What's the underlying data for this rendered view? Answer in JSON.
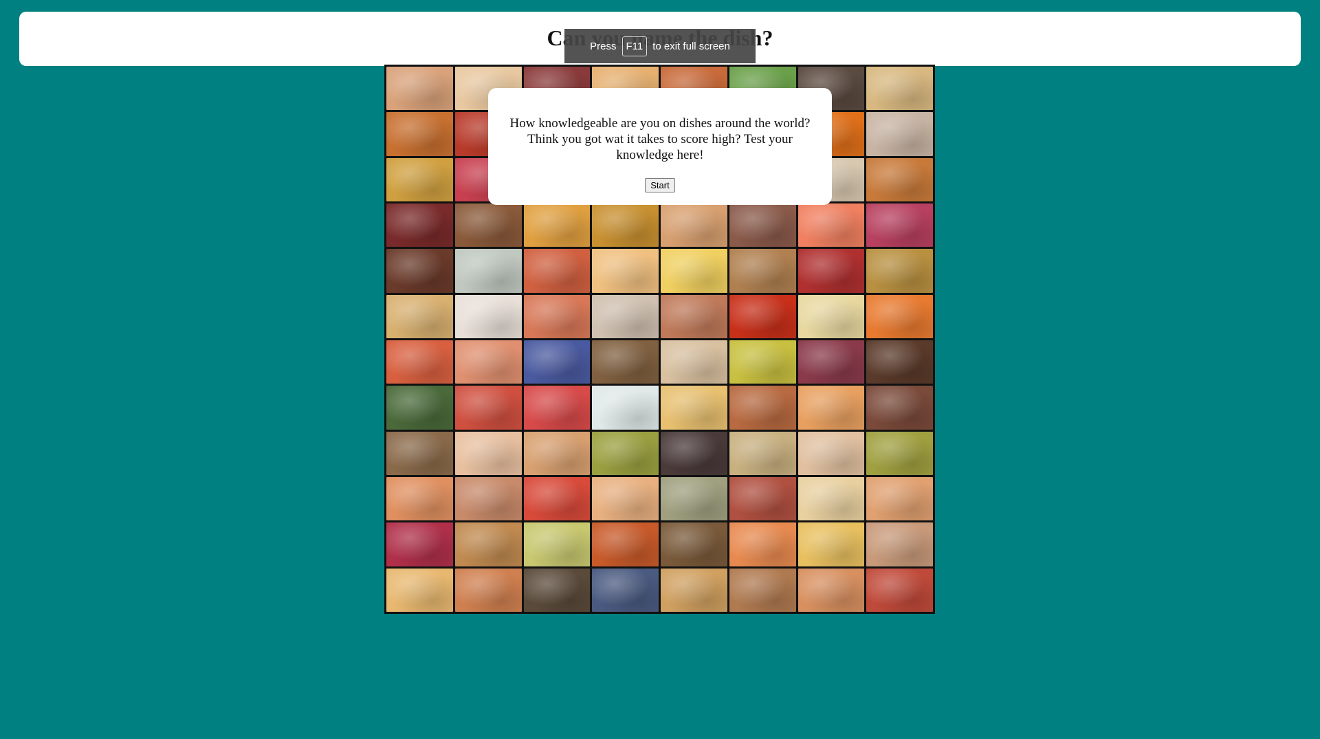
{
  "header": {
    "title": "Can you name the dish?"
  },
  "fullscreen_notice": {
    "prefix": "Press",
    "key": "F11",
    "suffix": "to exit full screen"
  },
  "modal": {
    "text": "How knowledgeable are you on dishes around the world? Think you got wat it takes to score high? Test your knowledge here!",
    "start_label": "Start"
  },
  "colors": {
    "background": "#008080",
    "panel": "#ffffff",
    "grid_border": "#111111"
  },
  "food_tiles": [
    "#d9a27a",
    "#e8c8a0",
    "#8a3a3a",
    "#e6b070",
    "#c86a3a",
    "#6aa04a",
    "#5a4a40",
    "#d8b880",
    "#c87030",
    "#b83a2a",
    "#c8a078",
    "#d8a040",
    "#c89058",
    "#d8b060",
    "#e0701a",
    "#c8b4a4",
    "#d0a040",
    "#c84050",
    "#7a5030",
    "#a06040",
    "#c09a6a",
    "#d8b88a",
    "#d8c8b0",
    "#c87a3a",
    "#7a2a2a",
    "#8a5a3a",
    "#e0a040",
    "#c89030",
    "#d8a070",
    "#8a5a4a",
    "#f08060",
    "#b84060",
    "#6a3a2a",
    "#c0c8c0",
    "#d06040",
    "#f0c080",
    "#f0d060",
    "#b08050",
    "#b03030",
    "#b89040",
    "#d8b070",
    "#e8e0d8",
    "#d87858",
    "#cfc0b0",
    "#c07a5a",
    "#c8301a",
    "#e8d8a0",
    "#e87a30",
    "#d86040",
    "#e09070",
    "#4a5aa0",
    "#806040",
    "#d8c0a0",
    "#c8c040",
    "#8a3a4a",
    "#5a3a2a",
    "#4a6a3a",
    "#d05040",
    "#d84a4a",
    "#e0e8e8",
    "#e8c070",
    "#b86a40",
    "#e8a060",
    "#7a4a3a",
    "#8a6a4a",
    "#e8c0a0",
    "#d8a070",
    "#9aa040",
    "#4a3a3a",
    "#c8b080",
    "#e0c0a0",
    "#a0a040",
    "#e09060",
    "#c88a6a",
    "#d84a3a",
    "#e8b080",
    "#a0a080",
    "#b05040",
    "#e8d0a0",
    "#e0a070",
    "#b0304a",
    "#c08a50",
    "#c8c870",
    "#c85a2a",
    "#7a5a3a",
    "#e88a50",
    "#e8c060",
    "#c89a7a",
    "#e8b870",
    "#d08050",
    "#5a4a3a",
    "#4a5a80",
    "#d0a060",
    "#b07a50",
    "#d89060",
    "#c04a3a"
  ]
}
